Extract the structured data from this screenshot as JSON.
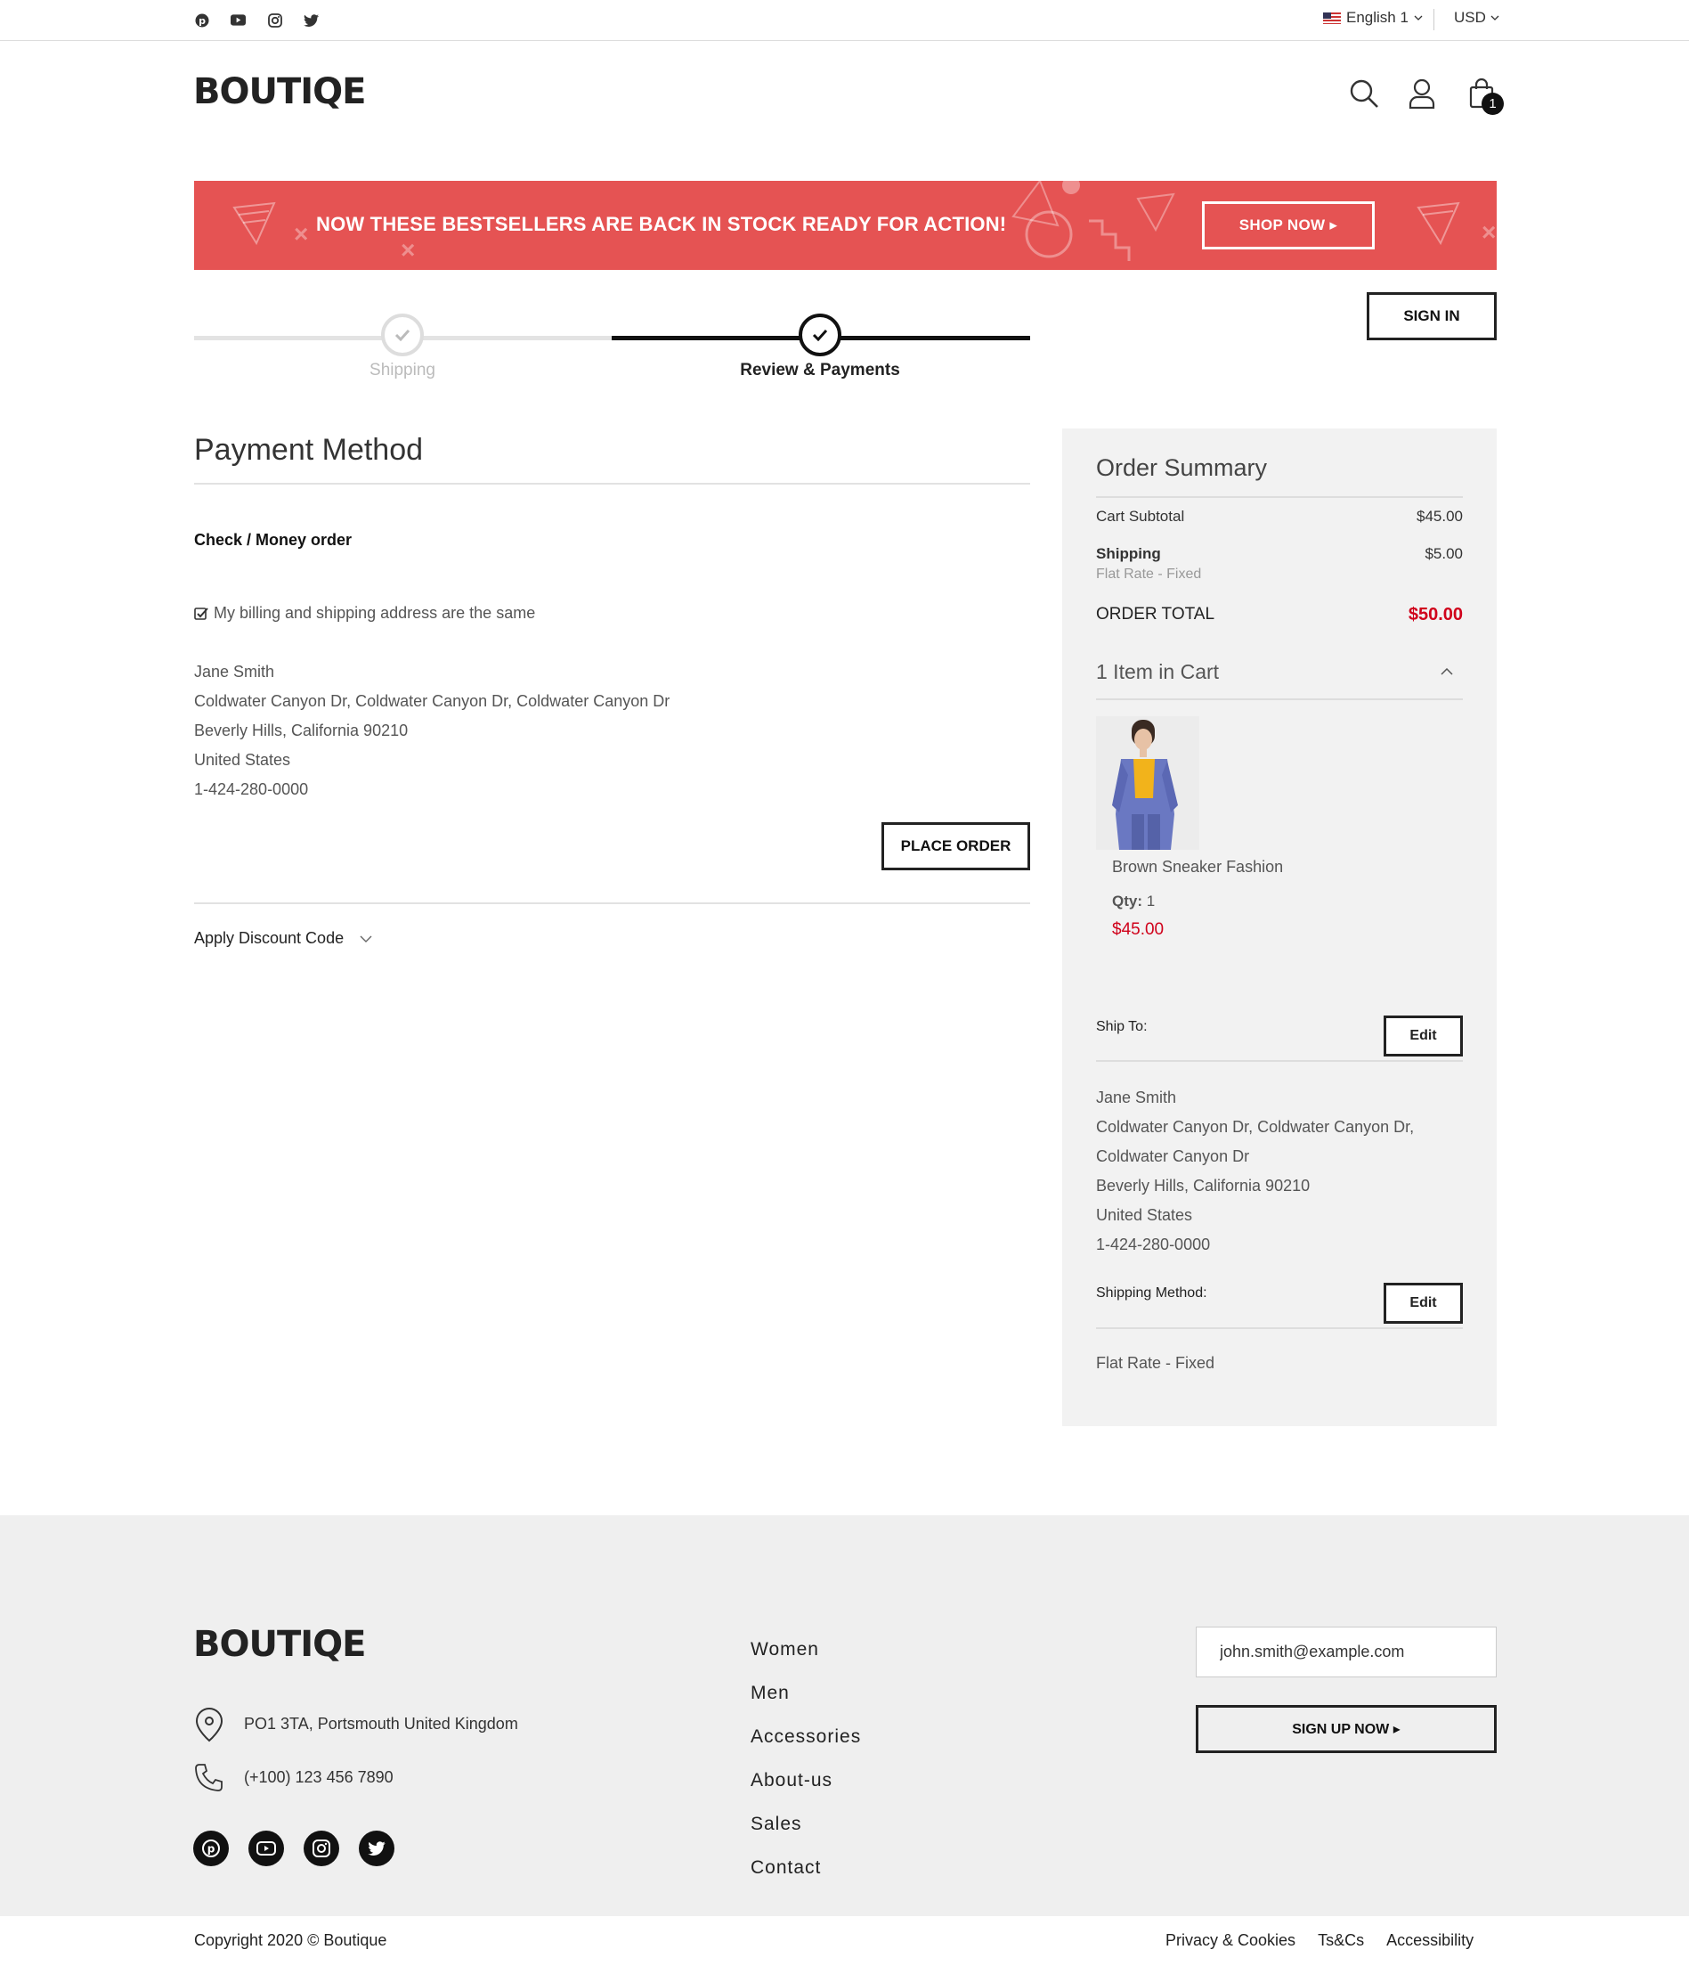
{
  "topbar": {
    "social": [
      "pinterest-icon",
      "youtube-icon",
      "instagram-icon",
      "twitter-icon"
    ],
    "language": "English 1",
    "currency": "USD"
  },
  "header": {
    "logo": "BOUTIQE",
    "cart_count": "1"
  },
  "banner": {
    "text": "NOW THESE BESTSELLERS ARE BACK IN STOCK READY FOR ACTION!",
    "cta": "SHOP NOW ▸",
    "color": "#e55353"
  },
  "signin": "SIGN IN",
  "progress": {
    "steps": [
      {
        "label": "Shipping",
        "state": "done"
      },
      {
        "label": "Review & Payments",
        "state": "active"
      }
    ]
  },
  "payment": {
    "title": "Payment Method",
    "method": "Check / Money order",
    "same_address": "My billing and shipping address are the same",
    "address": [
      "Jane Smith",
      "Coldwater Canyon Dr, Coldwater Canyon Dr, Coldwater Canyon Dr",
      "Beverly Hills, California 90210",
      "United States",
      "1-424-280-0000"
    ],
    "place_order": "PLACE ORDER",
    "discount": "Apply Discount Code"
  },
  "summary": {
    "title": "Order Summary",
    "subtotal_label": "Cart Subtotal",
    "subtotal_value": "$45.00",
    "shipping_label": "Shipping",
    "shipping_value": "$5.00",
    "shipping_method": "Flat Rate - Fixed",
    "total_label": "ORDER TOTAL",
    "total_value": "$50.00",
    "total_color": "#d0021b",
    "items_label": "1 Item in Cart",
    "item": {
      "name": "Brown Sneaker Fashion",
      "qty_label": "Qty:",
      "qty": "1",
      "price": "$45.00"
    },
    "ship_to_title": "Ship To:",
    "edit": "Edit",
    "ship_to": [
      "Jane Smith",
      "Coldwater Canyon Dr, Coldwater Canyon Dr,",
      "Coldwater Canyon Dr",
      "Beverly Hills, California 90210",
      "United States",
      "1-424-280-0000"
    ],
    "method_title": "Shipping Method:",
    "method_value": "Flat Rate - Fixed"
  },
  "footer": {
    "logo": "BOUTIQE",
    "address": "PO1 3TA, Portsmouth United Kingdom",
    "phone": "(+100) 123 456 7890",
    "links": [
      "Women",
      "Men",
      "Accessories",
      "About-us",
      "Sales",
      "Contact"
    ],
    "email_value": "john.smith@example.com",
    "signup": "SIGN UP NOW ▸",
    "copyright": "Copyright 2020 © Boutique",
    "legal": [
      "Privacy & Cookies",
      "Ts&Cs",
      "Accessibility"
    ]
  }
}
